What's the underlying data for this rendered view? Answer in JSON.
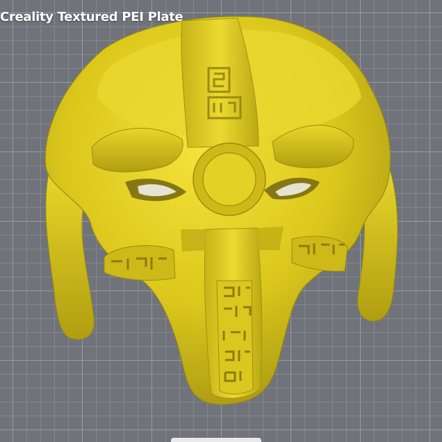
{
  "viewport": {
    "plate_label": "Creality Textured PEI Plate",
    "model_color": "#d9c61a",
    "grid_color": "#9a9ca3",
    "background_color": "#707379"
  }
}
